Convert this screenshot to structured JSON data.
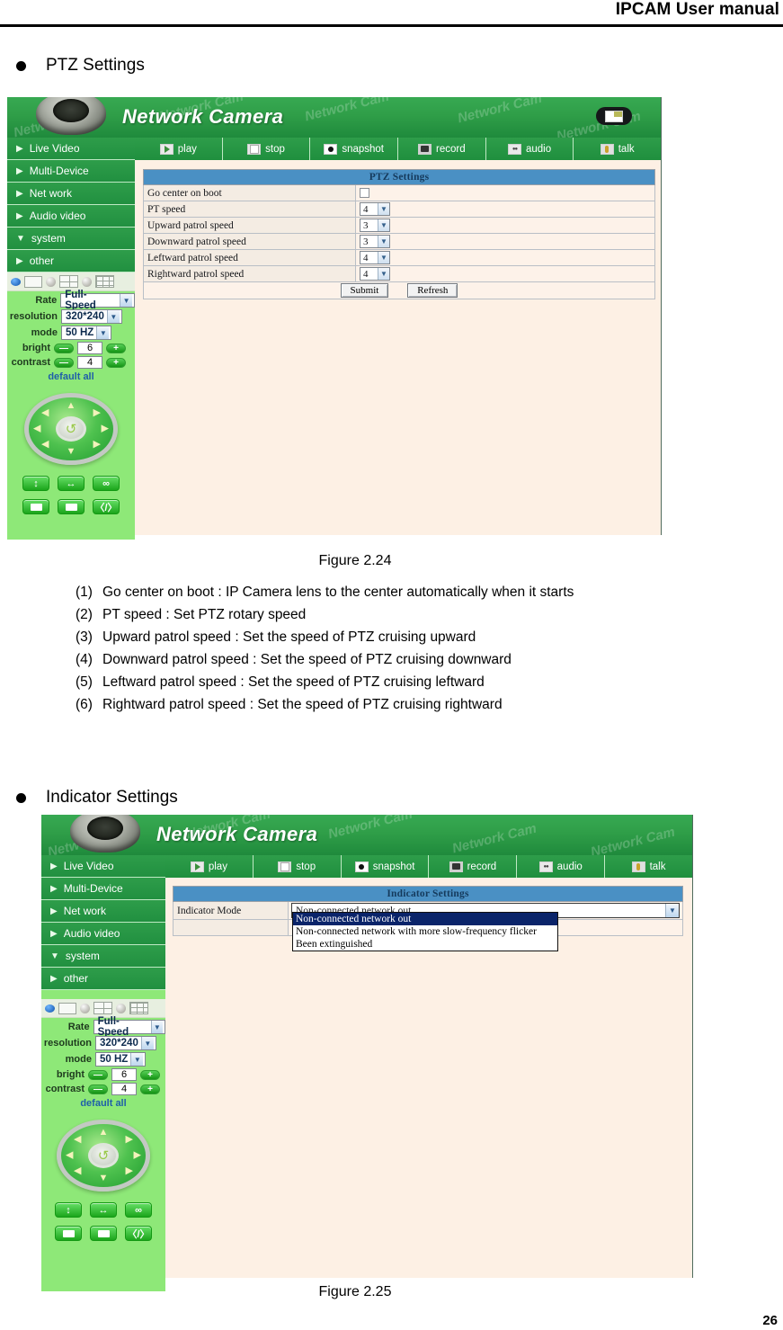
{
  "document": {
    "header_title": "IPCAM User manual",
    "page_number": "26"
  },
  "sections": [
    {
      "heading": "PTZ Settings",
      "figure_caption": "Figure 2.24"
    },
    {
      "heading": "Indicator Settings",
      "figure_caption": "Figure 2.25"
    }
  ],
  "camera_ui": {
    "brand_title": "Network Camera",
    "watermark": "Network Cam",
    "icons": {
      "dome_camera": "dome-camera-icon",
      "language": "language-switch-icon"
    },
    "sidebar": [
      {
        "label": "Live Video",
        "marker": "▶"
      },
      {
        "label": "Multi-Device",
        "marker": "▶"
      },
      {
        "label": "Net work",
        "marker": "▶"
      },
      {
        "label": "Audio video",
        "marker": "▶"
      },
      {
        "label": "system",
        "marker": "▼"
      },
      {
        "label": "other",
        "marker": "▶"
      }
    ],
    "toolbar": [
      {
        "label": "play",
        "icon": "play-icon"
      },
      {
        "label": "stop",
        "icon": "stop-icon"
      },
      {
        "label": "snapshot",
        "icon": "snapshot-icon"
      },
      {
        "label": "record",
        "icon": "record-icon"
      },
      {
        "label": "audio",
        "icon": "audio-icon"
      },
      {
        "label": "talk",
        "icon": "talk-icon"
      }
    ],
    "video_controls": {
      "rate_label": "Rate",
      "rate_value": "Full-Speed",
      "resolution_label": "resolution",
      "resolution_value": "320*240",
      "mode_label": "mode",
      "mode_value": "50 HZ",
      "bright_label": "bright",
      "bright_value": "6",
      "contrast_label": "contrast",
      "contrast_value": "4",
      "minus": "—",
      "plus": "+",
      "default_all": "default all"
    }
  },
  "ptz_panel": {
    "table_title": "PTZ Settings",
    "rows": [
      {
        "label": "Go center on boot",
        "control": "checkbox",
        "value": ""
      },
      {
        "label": "PT speed",
        "control": "select",
        "value": "4"
      },
      {
        "label": "Upward patrol speed",
        "control": "select",
        "value": "3"
      },
      {
        "label": "Downward patrol speed",
        "control": "select",
        "value": "3"
      },
      {
        "label": "Leftward patrol speed",
        "control": "select",
        "value": "4"
      },
      {
        "label": "Rightward patrol speed",
        "control": "select",
        "value": "4"
      }
    ],
    "submit_label": "Submit",
    "refresh_label": "Refresh"
  },
  "indicator_panel": {
    "table_title": "Indicator Settings",
    "field_label": "Indicator Mode",
    "selected_value": "Non-connected network out",
    "options": [
      "Non-connected network out",
      "Non-connected network with more slow-frequency flicker",
      "Been extinguished"
    ]
  },
  "ptz_descriptions": [
    {
      "num": "(1)",
      "text": "Go center on boot : IP Camera lens to the center automatically when it starts"
    },
    {
      "num": "(2)",
      "text": "PT speed : Set PTZ rotary speed"
    },
    {
      "num": "(3)",
      "text": "Upward patrol speed : Set the speed of PTZ cruising upward"
    },
    {
      "num": "(4)",
      "text": "Downward patrol speed : Set the speed of PTZ cruising downward"
    },
    {
      "num": "(5)",
      "text": "Leftward patrol speed : Set the speed of PTZ cruising leftward"
    },
    {
      "num": "(6)",
      "text": "Rightward patrol speed : Set the speed of PTZ cruising rightward"
    }
  ],
  "colors": {
    "nav_green": "#2e9d4a",
    "table_header_blue": "#4a90c4",
    "content_cream": "#fdf0e4",
    "panel_green": "#8ee878"
  }
}
